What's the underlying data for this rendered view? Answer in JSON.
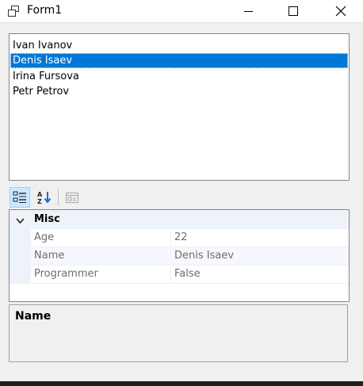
{
  "window": {
    "title": "Form1",
    "controls": {
      "minimize": "minimize-icon",
      "maximize": "maximize-icon",
      "close": "close-icon"
    }
  },
  "listbox": {
    "items": [
      {
        "label": "Ivan Ivanov",
        "selected": false
      },
      {
        "label": "Denis Isaev",
        "selected": true
      },
      {
        "label": "Irina Fursova",
        "selected": false
      },
      {
        "label": "Petr Petrov",
        "selected": false
      }
    ]
  },
  "toolbar": {
    "buttons": [
      {
        "icon": "categorized-icon",
        "active": true
      },
      {
        "icon": "alphabetical-icon",
        "active": false
      },
      {
        "icon": "property-pages-icon",
        "active": false,
        "disabled": true
      }
    ]
  },
  "propertygrid": {
    "category": "Misc",
    "properties": [
      {
        "name": "Age",
        "value": "22"
      },
      {
        "name": "Name",
        "value": "Denis Isaev"
      },
      {
        "name": "Programmer",
        "value": "False"
      }
    ]
  },
  "description": {
    "title": "Name"
  },
  "colors": {
    "selection": "#0078d7",
    "category_bg": "#eef3fa",
    "active_button": "#cce8ff"
  }
}
